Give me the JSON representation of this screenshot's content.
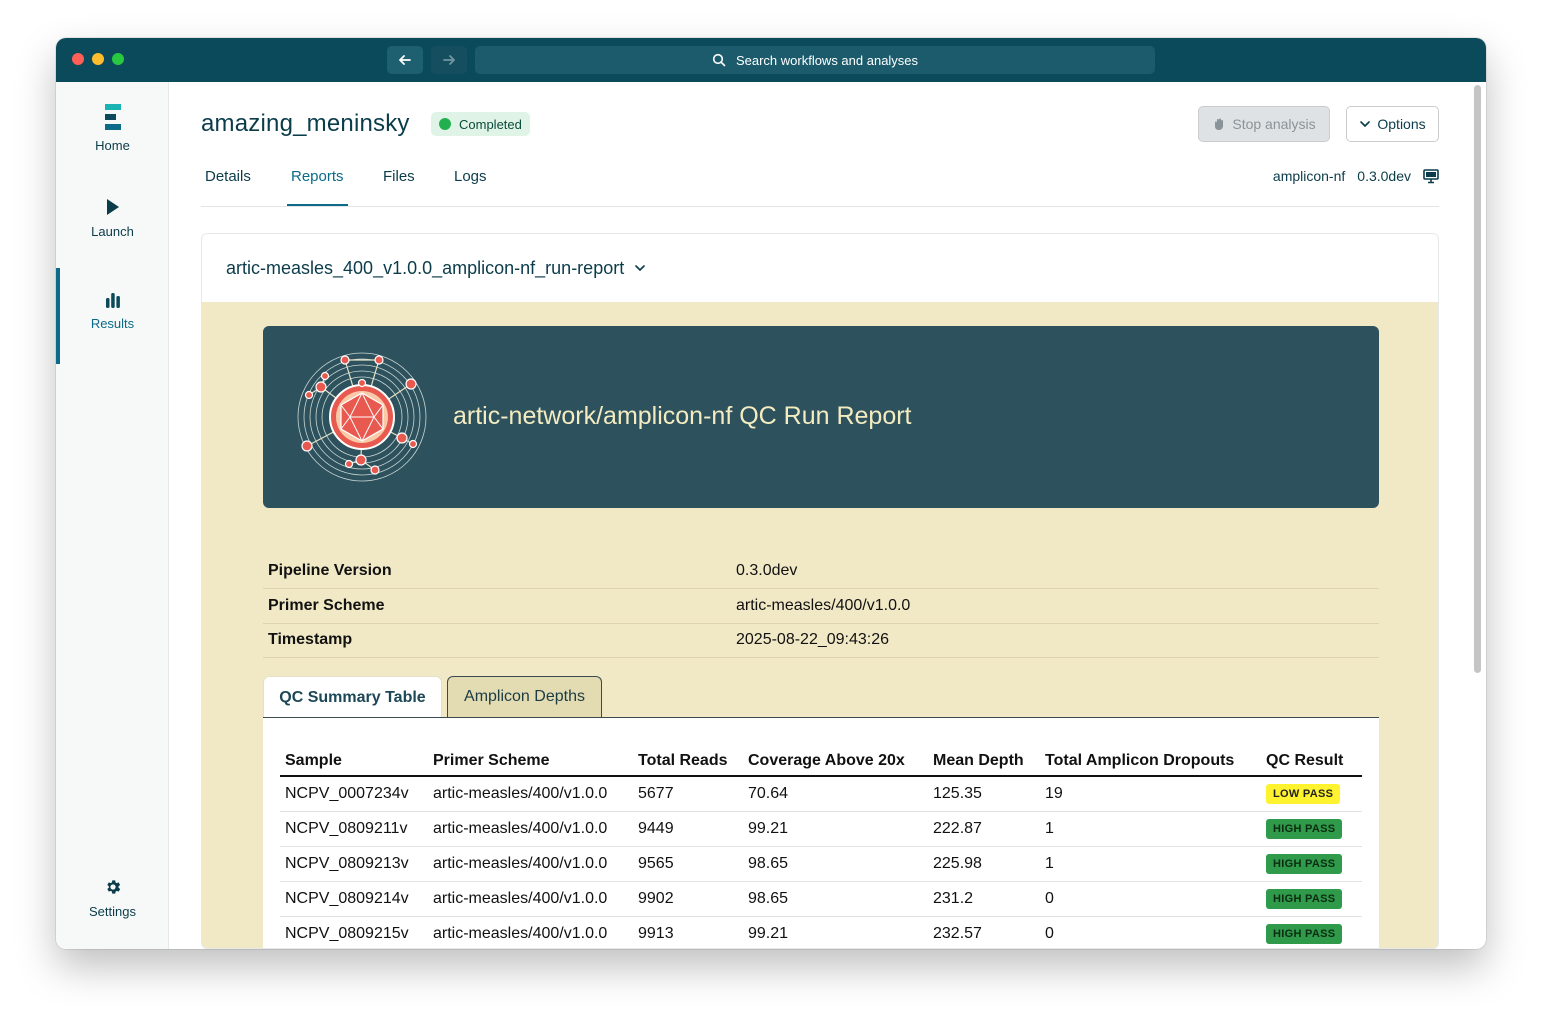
{
  "titlebar": {
    "search_placeholder": "Search workflows and analyses"
  },
  "sidebar": {
    "items": [
      {
        "label": "Home",
        "icon": "home-logo-icon"
      },
      {
        "label": "Launch",
        "icon": "play-icon"
      },
      {
        "label": "Results",
        "icon": "bar-chart-icon",
        "active": true
      },
      {
        "label": "Settings",
        "icon": "gear-icon"
      }
    ]
  },
  "header": {
    "run_name": "amazing_meninsky",
    "status": "Completed",
    "stop_label": "Stop analysis",
    "options_label": "Options"
  },
  "tabs": [
    {
      "label": "Details"
    },
    {
      "label": "Reports",
      "active": true
    },
    {
      "label": "Files"
    },
    {
      "label": "Logs"
    }
  ],
  "pipeline": {
    "name": "amplicon-nf",
    "version": "0.3.0dev"
  },
  "report": {
    "selected": "artic-measles_400_v1.0.0_amplicon-nf_run-report",
    "banner_title": "artic-network/amplicon-nf QC Run Report",
    "meta": [
      {
        "key": "Pipeline Version",
        "value": "0.3.0dev"
      },
      {
        "key": "Primer Scheme",
        "value": "artic-measles/400/v1.0.0"
      },
      {
        "key": "Timestamp",
        "value": "2025-08-22_09:43:26"
      }
    ],
    "qc_tabs": [
      {
        "label": "QC Summary Table",
        "active": true
      },
      {
        "label": "Amplicon Depths"
      }
    ],
    "qc_table": {
      "columns": [
        "Sample",
        "Primer Scheme",
        "Total Reads",
        "Coverage Above 20x",
        "Mean Depth",
        "Total Amplicon Dropouts",
        "QC Result"
      ],
      "rows": [
        [
          "NCPV_0007234v",
          "artic-measles/400/v1.0.0",
          "5677",
          "70.64",
          "125.35",
          "19",
          "LOW PASS"
        ],
        [
          "NCPV_0809211v",
          "artic-measles/400/v1.0.0",
          "9449",
          "99.21",
          "222.87",
          "1",
          "HIGH PASS"
        ],
        [
          "NCPV_0809213v",
          "artic-measles/400/v1.0.0",
          "9565",
          "98.65",
          "225.98",
          "1",
          "HIGH PASS"
        ],
        [
          "NCPV_0809214v",
          "artic-measles/400/v1.0.0",
          "9902",
          "98.65",
          "231.2",
          "0",
          "HIGH PASS"
        ],
        [
          "NCPV_0809215v",
          "artic-measles/400/v1.0.0",
          "9913",
          "99.21",
          "232.57",
          "0",
          "HIGH PASS"
        ]
      ]
    }
  },
  "colors": {
    "brand_dark": "#0b4a5a",
    "accent": "#0b6b88",
    "report_bg": "#f1e9c6",
    "banner_bg": "#2d525e",
    "low_pass": "#fff22e",
    "high_pass": "#2e9a4a"
  }
}
